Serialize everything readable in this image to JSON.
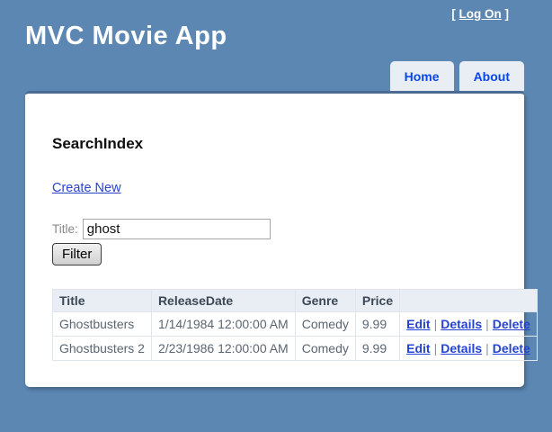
{
  "colors": {
    "page_background": "#5c87b2",
    "card_top_border": "#4b6b92",
    "tab_background": "#e8eef4",
    "tab_text": "#0847e8",
    "table_header_background": "#e8eef4",
    "link_color": "#2a43cf",
    "cell_text": "#5b6572"
  },
  "header": {
    "title": "MVC Movie App",
    "login": {
      "prefix": "[ ",
      "link": "Log On",
      "suffix": " ]"
    },
    "menu": [
      {
        "label": "Home"
      },
      {
        "label": "About"
      }
    ]
  },
  "main": {
    "heading": "SearchIndex",
    "create_link": "Create New",
    "filter_form": {
      "label": "Title:",
      "value": "ghost",
      "button": "Filter"
    },
    "table": {
      "headers": [
        "Title",
        "ReleaseDate",
        "Genre",
        "Price",
        ""
      ],
      "separator": "|",
      "rows": [
        {
          "title": "Ghostbusters",
          "release_date": "1/14/1984 12:00:00 AM",
          "genre": "Comedy",
          "price": "9.99",
          "actions": [
            "Edit",
            "Details",
            "Delete"
          ]
        },
        {
          "title": "Ghostbusters 2",
          "release_date": "2/23/1986 12:00:00 AM",
          "genre": "Comedy",
          "price": "9.99",
          "actions": [
            "Edit",
            "Details",
            "Delete"
          ]
        }
      ]
    }
  }
}
